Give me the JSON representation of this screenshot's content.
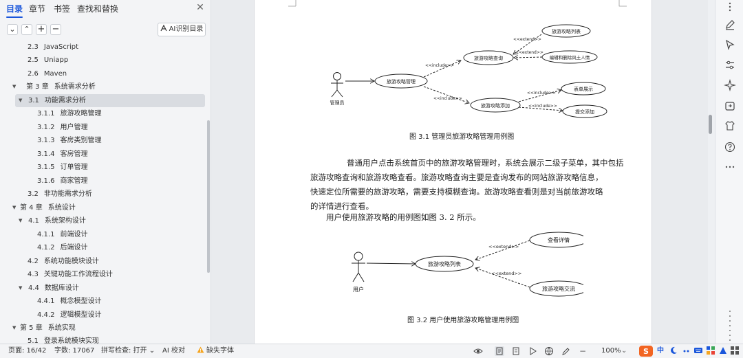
{
  "nav": {
    "tabs": [
      "目录",
      "章节",
      "书签",
      "查找和替换"
    ],
    "close_icon": "close-icon",
    "ai_toc_label": "AI识别目录",
    "toolbar_icons": [
      "chevron-down-icon",
      "chevron-up-icon",
      "plus-icon",
      "minus-icon"
    ],
    "toc": [
      {
        "num": "2.3",
        "label": "JavaScript"
      },
      {
        "num": "2.5",
        "label": "Uniapp"
      },
      {
        "num": "2.6",
        "label": "Maven"
      },
      {
        "num": "第 3 章",
        "label": "系统需求分析"
      },
      {
        "num": "3.1",
        "label": "功能需求分析"
      },
      {
        "num": "3.1.1",
        "label": "旅游攻略管理"
      },
      {
        "num": "3.1.2",
        "label": "用户管理"
      },
      {
        "num": "3.1.3",
        "label": "客房类别管理"
      },
      {
        "num": "3.1.4",
        "label": "客房管理"
      },
      {
        "num": "3.1.5",
        "label": "订单管理"
      },
      {
        "num": "3.1.6",
        "label": "商家管理"
      },
      {
        "num": "3.2",
        "label": "非功能需求分析"
      },
      {
        "num": "第 4 章",
        "label": "系统设计"
      },
      {
        "num": "4.1",
        "label": "系统架构设计"
      },
      {
        "num": "4.1.1",
        "label": "前端设计"
      },
      {
        "num": "4.1.2",
        "label": "后端设计"
      },
      {
        "num": "4.2",
        "label": "系统功能模块设计"
      },
      {
        "num": "4.3",
        "label": "关键功能工作流程设计"
      },
      {
        "num": "4.4",
        "label": "数据库设计"
      },
      {
        "num": "4.4.1",
        "label": "概念模型设计"
      },
      {
        "num": "4.4.2",
        "label": "逻辑模型设计"
      },
      {
        "num": "第 5 章",
        "label": "系统实现"
      },
      {
        "num": "5.1",
        "label": "登录系统模块实现"
      }
    ]
  },
  "doc": {
    "figure1": {
      "actor": "管理员",
      "main_usecase": "旅游攻略管理",
      "include_label": "<<include>>",
      "extend_label": "<<extend>>",
      "query": "旅游攻略查询",
      "add": "旅游攻略添加",
      "list": "旅游攻略列表",
      "edit_delete": "编辑和删除风土人情",
      "form": "表单展示",
      "submit": "提交添加",
      "caption": "图 3.1 管理员旅游攻略管理用例图"
    },
    "paragraph_lines": [
      "普通用户点击系统首页中的旅游攻略管理时，系统会展示二级子菜单，其中包括",
      "旅游攻略查询和旅游攻略查看。旅游攻略查询主要是查询发布的网站旅游攻略信息，",
      "快速定位所需要的旅游攻略，需要支持模糊查询。旅游攻略查看则是对当前旅游攻略",
      "的详情进行查看。"
    ],
    "paragraph2": "用户使用旅游攻略的用例图如图 3. 2 所示。",
    "figure2": {
      "actor": "用户",
      "main_usecase": "旅游攻略列表",
      "extend_label": "<<extend>>",
      "detail": "查看详情",
      "exchange": "旅游攻略交流",
      "caption": "图 3.2 用户使用旅游攻略管理用例图"
    }
  },
  "status": {
    "page": "页面: 16/42",
    "words": "字数: 17067",
    "spellcheck": "拼写检查: 打开",
    "ai_check": "AI 校对",
    "missing_font": "缺失字体",
    "zoom": "100%",
    "ime": "中"
  },
  "right_rail_icons": [
    "more-dots-icon",
    "pen-icon",
    "cursor-icon",
    "sliders-icon",
    "sparkle-icon",
    "share-icon",
    "shirt-icon",
    "help-icon",
    "ellipsis-icon"
  ],
  "colors": {
    "accent": "#1a56db",
    "selected_row": "#d9dce1",
    "warning": "#f5a623",
    "brand_orange": "#f26522"
  }
}
